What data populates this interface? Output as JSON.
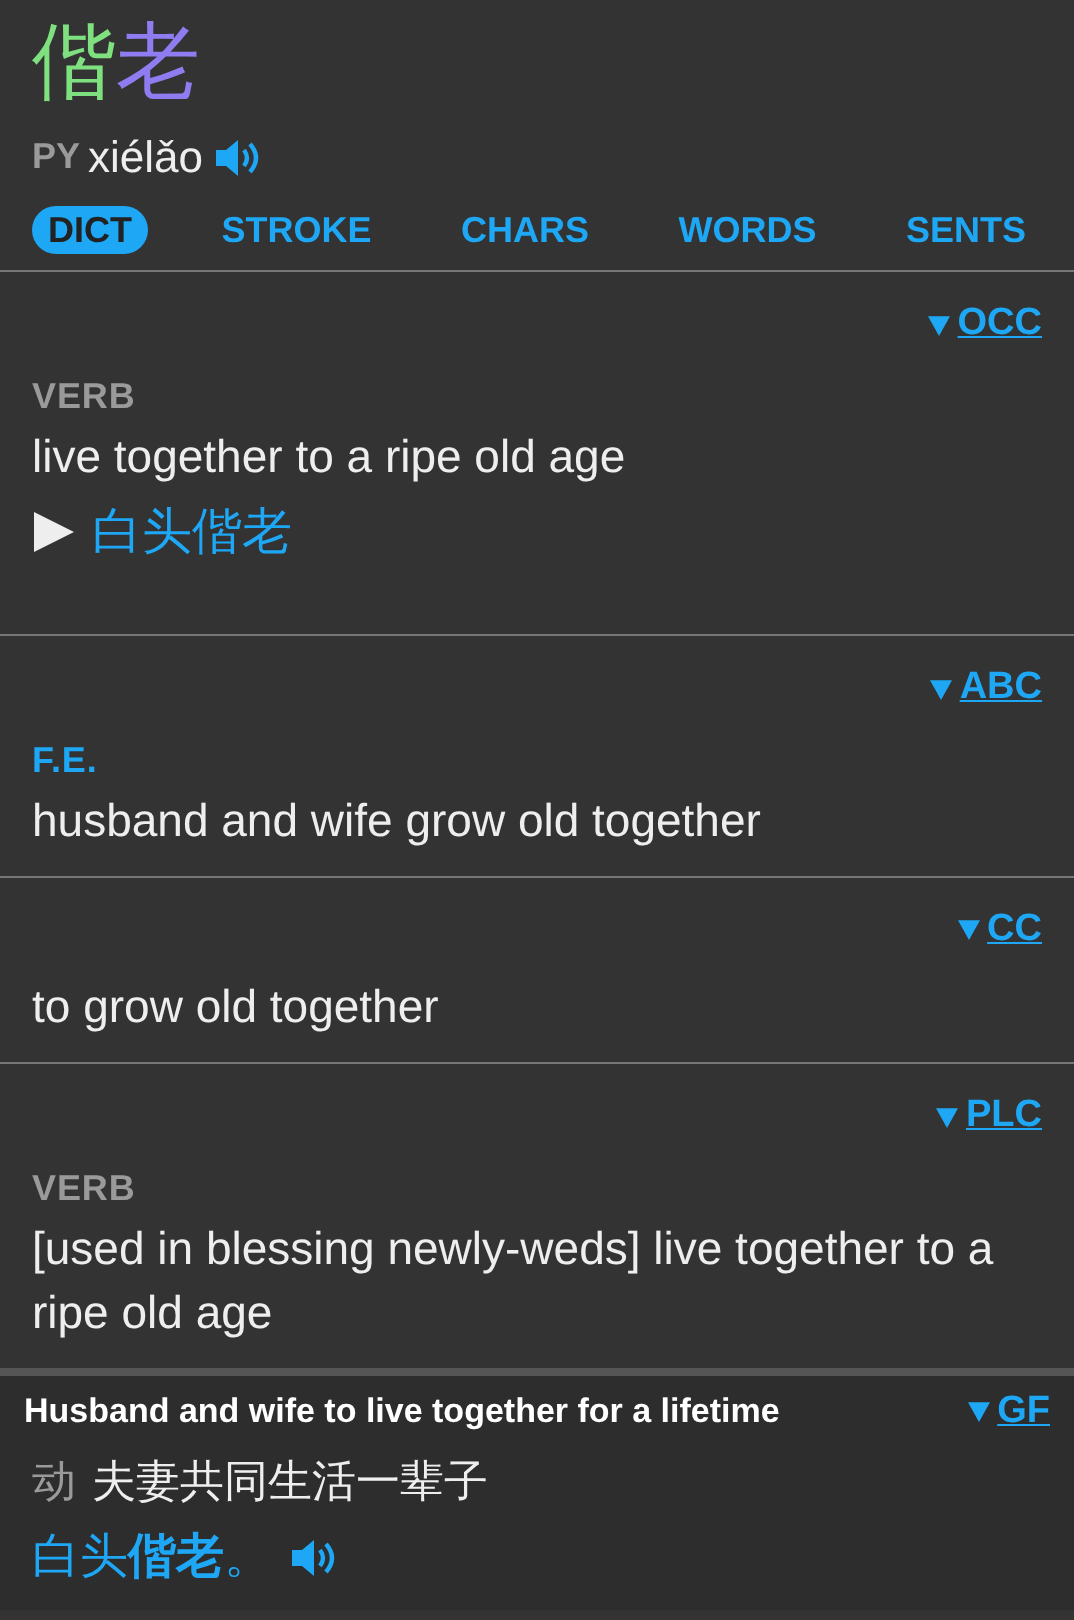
{
  "headword": [
    {
      "char": "偕",
      "color": "#7ee07e"
    },
    {
      "char": "老",
      "color": "#8f7cf0"
    }
  ],
  "pinyin": {
    "label": "PY",
    "text": "xiélǎo"
  },
  "tabs": [
    {
      "label": "DICT",
      "selected": true
    },
    {
      "label": "STROKE",
      "selected": false
    },
    {
      "label": "CHARS",
      "selected": false
    },
    {
      "label": "WORDS",
      "selected": false
    },
    {
      "label": "SENTS",
      "selected": false
    }
  ],
  "entries": [
    {
      "kind": "dict",
      "source": "OCC",
      "label": {
        "kind": "pos",
        "text": "VERB"
      },
      "definition": "live together to a ripe old age",
      "example": "白头偕老"
    },
    {
      "kind": "dict",
      "source": "ABC",
      "label": {
        "kind": "usage",
        "text": "F.E."
      },
      "definition": "husband and wife grow old together"
    },
    {
      "kind": "dict",
      "source": "CC",
      "definition": "to grow old together"
    },
    {
      "kind": "dict",
      "source": "PLC",
      "label": {
        "kind": "pos",
        "text": "VERB"
      },
      "definition": "[used in blessing newly-weds] live together to a ripe old age"
    },
    {
      "kind": "gf",
      "title": "Husband and wife to live together for a lifetime",
      "source": "GF",
      "label": "动",
      "definition": "夫妻共同生活一辈子",
      "example": "白头**偕老**。"
    }
  ]
}
